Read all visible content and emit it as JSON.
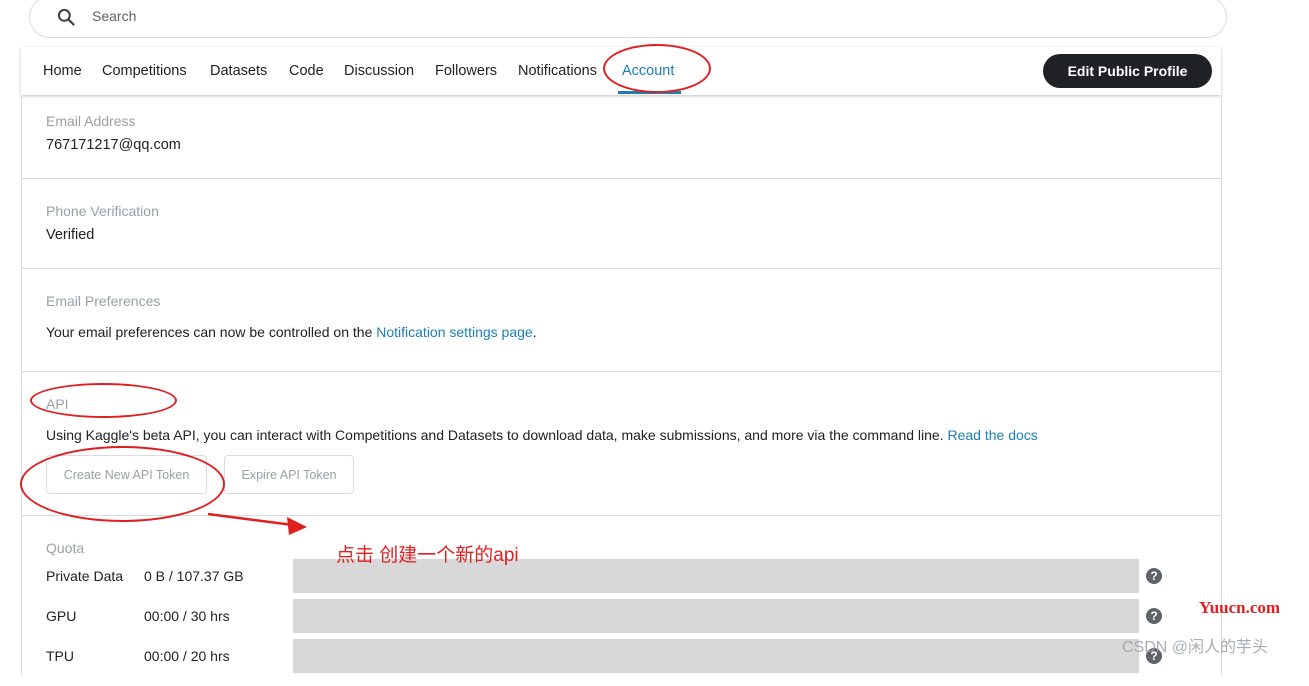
{
  "search": {
    "placeholder": "Search"
  },
  "nav": {
    "tabs": [
      {
        "label": "Home"
      },
      {
        "label": "Competitions"
      },
      {
        "label": "Datasets"
      },
      {
        "label": "Code"
      },
      {
        "label": "Discussion"
      },
      {
        "label": "Followers"
      },
      {
        "label": "Notifications"
      },
      {
        "label": "Account"
      }
    ],
    "active_tab": "Account",
    "edit_profile_label": "Edit Public Profile"
  },
  "account": {
    "email": {
      "label": "Email Address",
      "value": "767171217@qq.com"
    },
    "phone": {
      "label": "Phone Verification",
      "value": "Verified"
    },
    "email_prefs": {
      "label": "Email Preferences",
      "text": "Your email preferences can now be controlled on the ",
      "link": "Notification settings page",
      "suffix": "."
    },
    "api": {
      "label": "API",
      "text": "Using Kaggle's beta API, you can interact with Competitions and Datasets to download data, make submissions, and more via the command line. ",
      "link": "Read the docs",
      "create_button": "Create New API Token",
      "expire_button": "Expire API Token"
    },
    "quota": {
      "label": "Quota",
      "rows": [
        {
          "name": "Private Data",
          "value": "0 B / 107.37 GB",
          "fraction": 0
        },
        {
          "name": "GPU",
          "value": "00:00 / 30 hrs",
          "fraction": 0
        },
        {
          "name": "TPU",
          "value": "00:00 / 20 hrs",
          "fraction": 0
        }
      ]
    }
  },
  "annotation": {
    "text": "点击 创建一个新的api",
    "color": "#e02020"
  },
  "watermarks": {
    "site": "Yuucn.com",
    "author": "CSDN @闲人的芋头"
  }
}
